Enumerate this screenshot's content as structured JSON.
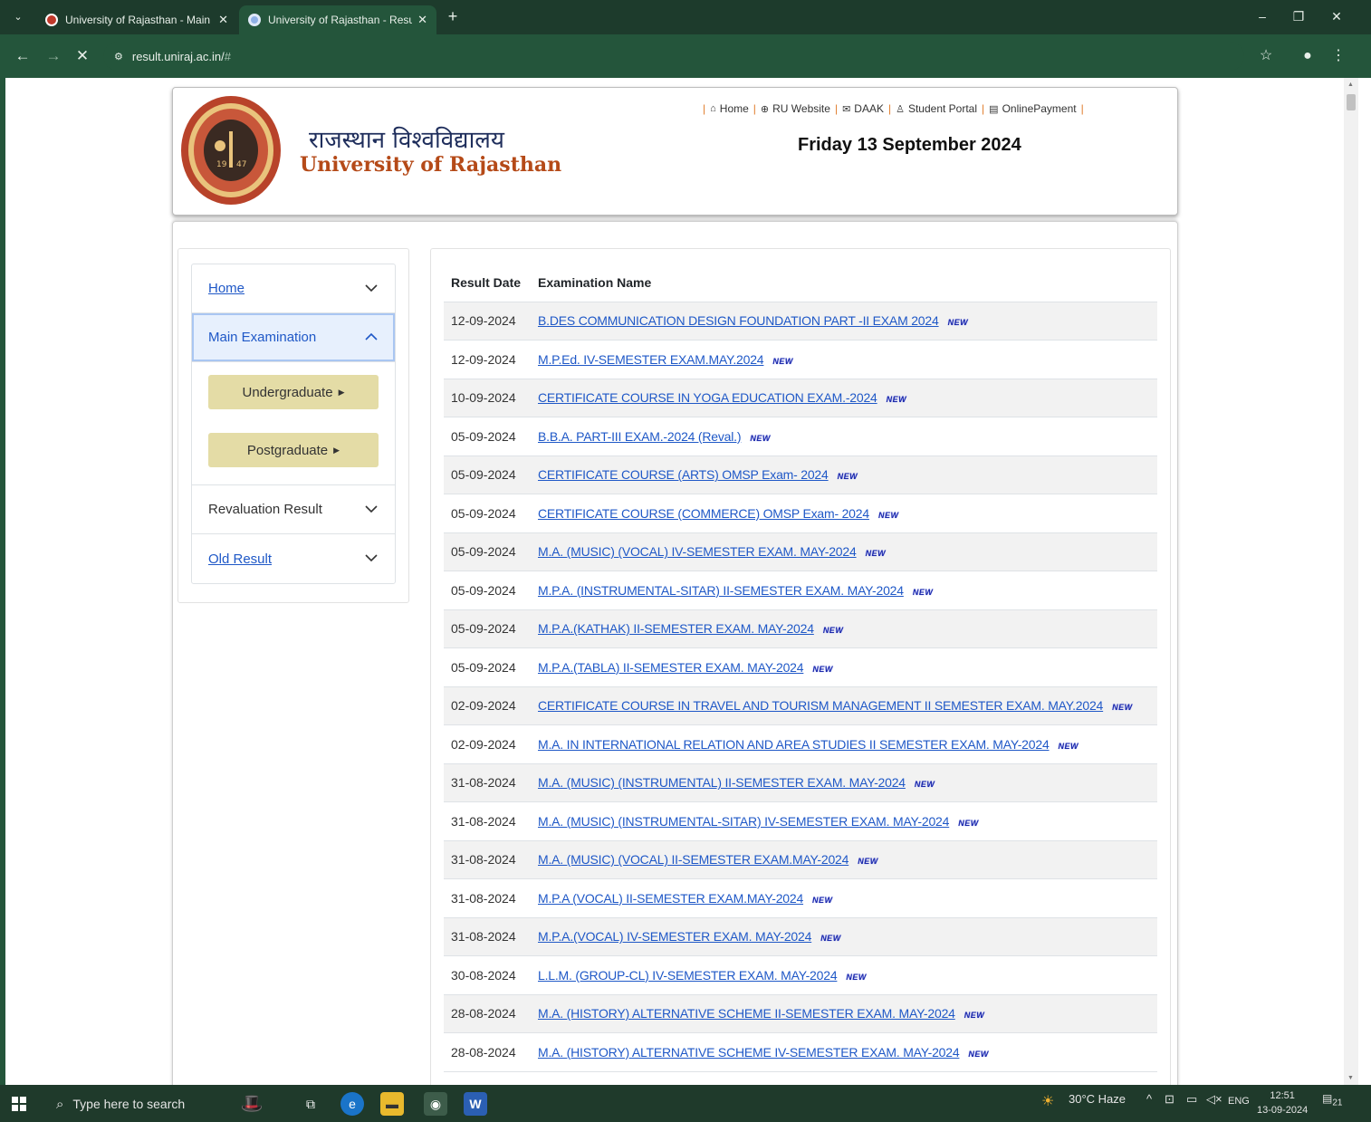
{
  "browser": {
    "tabs": [
      {
        "title": "University of Rajasthan - Main V",
        "active": false
      },
      {
        "title": "University of Rajasthan - Result",
        "active": true
      }
    ],
    "url_host": "result.uniraj.ac.in/",
    "url_hash": "#"
  },
  "header": {
    "title_hindi": "राजस्थान विश्वविद्यालय",
    "title_english": "University of Rajasthan",
    "date": "Friday 13 September 2024",
    "links": [
      "Home",
      "RU Website",
      "DAAK",
      "Student Portal",
      "OnlinePayment"
    ]
  },
  "sidebar": {
    "home": "Home",
    "main_exam": "Main Examination",
    "undergraduate": "Undergraduate",
    "postgraduate": "Postgraduate",
    "revaluation": "Revaluation Result",
    "old_result": "Old Result"
  },
  "table": {
    "col_date": "Result Date",
    "col_name": "Examination Name",
    "new_badge": "NEW",
    "rows": [
      {
        "date": "12-09-2024",
        "name": "B.DES COMMUNICATION DESIGN FOUNDATION PART -II EXAM 2024"
      },
      {
        "date": "12-09-2024",
        "name": "M.P.Ed. IV-SEMESTER EXAM.MAY.2024"
      },
      {
        "date": "10-09-2024",
        "name": "CERTIFICATE COURSE IN YOGA EDUCATION EXAM.-2024"
      },
      {
        "date": "05-09-2024",
        "name": "B.B.A. PART-III EXAM.-2024 (Reval.)"
      },
      {
        "date": "05-09-2024",
        "name": "CERTIFICATE COURSE (ARTS) OMSP Exam- 2024"
      },
      {
        "date": "05-09-2024",
        "name": "CERTIFICATE COURSE (COMMERCE) OMSP Exam- 2024"
      },
      {
        "date": "05-09-2024",
        "name": "M.A. (MUSIC) (VOCAL) IV-SEMESTER EXAM. MAY-2024"
      },
      {
        "date": "05-09-2024",
        "name": "M.P.A. (INSTRUMENTAL-SITAR) II-SEMESTER EXAM. MAY-2024"
      },
      {
        "date": "05-09-2024",
        "name": "M.P.A.(KATHAK) II-SEMESTER EXAM. MAY-2024"
      },
      {
        "date": "05-09-2024",
        "name": "M.P.A.(TABLA) II-SEMESTER EXAM. MAY-2024"
      },
      {
        "date": "02-09-2024",
        "name": "CERTIFICATE COURSE IN TRAVEL AND TOURISM MANAGEMENT II SEMESTER EXAM. MAY.2024"
      },
      {
        "date": "02-09-2024",
        "name": "M.A. IN INTERNATIONAL RELATION AND AREA STUDIES II SEMESTER EXAM. MAY-2024"
      },
      {
        "date": "31-08-2024",
        "name": "M.A. (MUSIC) (INSTRUMENTAL) II-SEMESTER EXAM. MAY-2024"
      },
      {
        "date": "31-08-2024",
        "name": "M.A. (MUSIC) (INSTRUMENTAL-SITAR) IV-SEMESTER EXAM. MAY-2024"
      },
      {
        "date": "31-08-2024",
        "name": "M.A. (MUSIC) (VOCAL) II-SEMESTER EXAM.MAY-2024"
      },
      {
        "date": "31-08-2024",
        "name": "M.P.A (VOCAL) II-SEMESTER EXAM.MAY-2024"
      },
      {
        "date": "31-08-2024",
        "name": "M.P.A.(VOCAL) IV-SEMESTER EXAM. MAY-2024"
      },
      {
        "date": "30-08-2024",
        "name": "L.L.M. (GROUP-CL) IV-SEMESTER EXAM. MAY-2024"
      },
      {
        "date": "28-08-2024",
        "name": "M.A. (HISTORY) ALTERNATIVE SCHEME II-SEMESTER EXAM. MAY-2024"
      },
      {
        "date": "28-08-2024",
        "name": "M.A. (HISTORY) ALTERNATIVE SCHEME IV-SEMESTER EXAM. MAY-2024"
      }
    ]
  },
  "taskbar": {
    "search_placeholder": "Type here to search",
    "weather": "30°C  Haze",
    "lang": "ENG",
    "time": "12:51",
    "date": "13-09-2024",
    "notif_count": "21"
  },
  "colors": {
    "chrome_dark": "#1d3b2c",
    "chrome_bar": "#24553b",
    "link_blue": "#1f58c7",
    "university_orange": "#b54a18",
    "subbutton_bg": "#e4dca6"
  }
}
